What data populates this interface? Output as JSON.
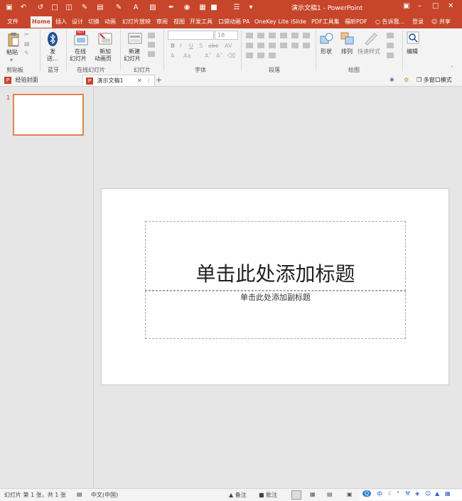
{
  "window": {
    "title": "演示文稿1 - PowerPoint"
  },
  "ribbon_tabs": [
    "文件",
    "Home",
    "插入",
    "设计",
    "切换",
    "动画",
    "幻灯片放映",
    "审阅",
    "视图",
    "开发工具",
    "口袋动画 PA",
    "OneKey Lite",
    "iSlide",
    "PDF工具集",
    "福昕PDF",
    "告诉我...",
    "登录",
    "共享"
  ],
  "ribbon": {
    "paste_label": "粘贴",
    "send_label_1": "发",
    "send_label_2": "送...",
    "online_slide_1": "在线",
    "online_slide_2": "幻灯片",
    "new_anim_1": "新加",
    "new_anim_2": "动画页",
    "new_slide_1": "新建",
    "new_slide_2": "幻灯片",
    "font_size_value": "18",
    "shape_label": "形状",
    "arrange_label": "排列",
    "quick_style_label": "快速样式",
    "edit_label": "编辑",
    "hot_badge": "HOT",
    "groups": {
      "clipboard": "剪贴板",
      "bluetooth": "蓝牙",
      "online_slides": "在线幻灯片",
      "slides": "幻灯片",
      "font": "字体",
      "paragraph": "段落",
      "drawing": "绘图"
    }
  },
  "doc_tabs": {
    "tab1": "经验封面",
    "tab2": "演示文稿1",
    "add": "+",
    "multi_window": "多窗口模式"
  },
  "thumbnails": {
    "slide_number": "1"
  },
  "slide": {
    "title_placeholder": "单击此处添加标题",
    "subtitle_placeholder": "单击此处添加副标题"
  },
  "status": {
    "slide_info": "幻灯片 第 1 张，共 1 张",
    "language": "中文(中国)",
    "notes": "备注",
    "comments": "批注",
    "ime": "中"
  },
  "colors": {
    "accent": "#c7452a",
    "ribbon_bg": "#f3f3f3",
    "canvas_bg": "#e6e6e6"
  }
}
